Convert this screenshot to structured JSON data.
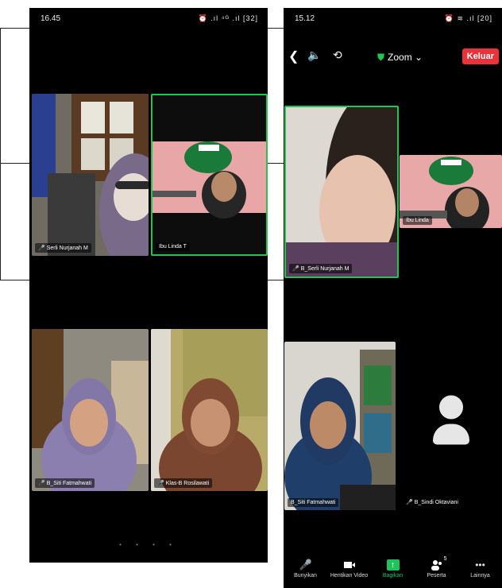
{
  "screen1": {
    "time": "16.45",
    "status_icons": "⏰ .ıl ⁴ᴳ .ıl [32]",
    "participants": [
      {
        "name": "Serli Nurjanah M",
        "muted": true,
        "active": false
      },
      {
        "name": "Ibu Linda T",
        "muted": false,
        "active": true
      },
      {
        "name": "B_Siti Fatmahwati",
        "muted": true,
        "active": false
      },
      {
        "name": "Klas-B Rosilawati",
        "muted": true,
        "active": false
      }
    ],
    "page_dots": "• • • •"
  },
  "screen2": {
    "time": "15.12",
    "status_icons": "⏰ ≋ .ıl [20]",
    "app_title": "Zoom",
    "leave_label": "Keluar",
    "participants": [
      {
        "name": "B_Serli Nurjanah M",
        "muted": true
      },
      {
        "name": "Ibu Linda",
        "muted": false
      },
      {
        "name": "B_Siti Fatmahwati",
        "muted": false
      },
      {
        "name": "B_Sindi Oktaviani",
        "muted": true
      }
    ],
    "toolbar": {
      "unmute": "Bunyikan",
      "stop_video": "Hentikan Video",
      "share": "Bagikan",
      "participants": "Peserta",
      "participants_count": "5",
      "more": "Lainnya"
    }
  },
  "colors": {
    "active_border": "#23c552",
    "leave": "#e8333a",
    "share": "#1ec35b"
  }
}
